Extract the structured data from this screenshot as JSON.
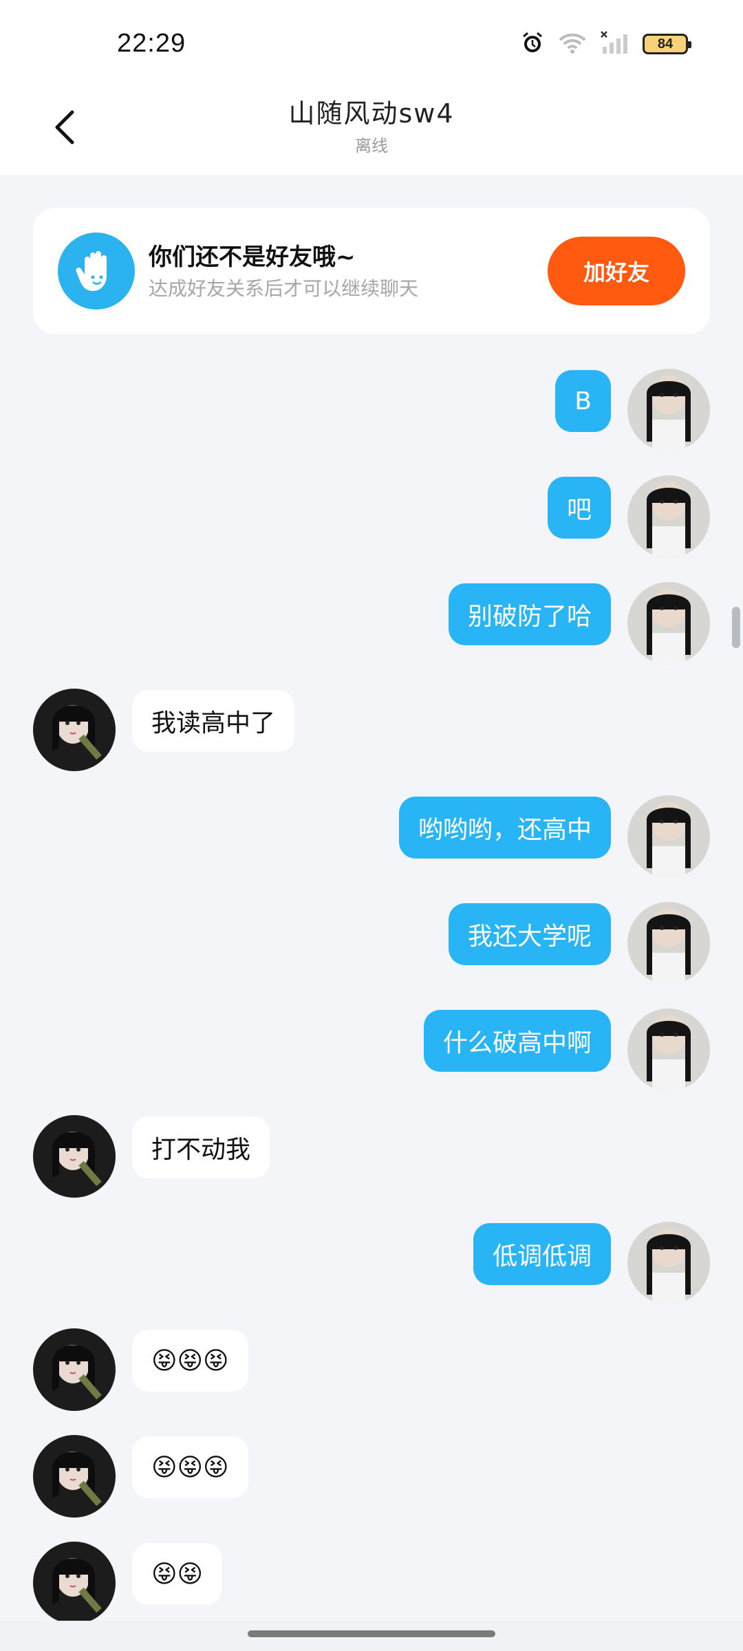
{
  "status_bar": {
    "time": "22:29",
    "battery": "84"
  },
  "header": {
    "title": "山随风动sw4",
    "subtitle": "离线"
  },
  "friend_card": {
    "title": "你们还不是好友哦~",
    "description": "达成好友关系后才可以继续聊天",
    "button": "加好友"
  },
  "messages": [
    {
      "side": "out",
      "text": "B"
    },
    {
      "side": "out",
      "text": "吧"
    },
    {
      "side": "out",
      "text": "别破防了哈"
    },
    {
      "side": "in",
      "text": "我读高中了"
    },
    {
      "side": "out",
      "text": "哟哟哟，还高中"
    },
    {
      "side": "out",
      "text": "我还大学呢"
    },
    {
      "side": "out",
      "text": "什么破高中啊"
    },
    {
      "side": "in",
      "text": "打不动我"
    },
    {
      "side": "out",
      "text": "低调低调"
    },
    {
      "side": "in",
      "text": "😝😝😝"
    },
    {
      "side": "in",
      "text": "😝😝😝"
    },
    {
      "side": "in",
      "text": "😝😝"
    }
  ]
}
